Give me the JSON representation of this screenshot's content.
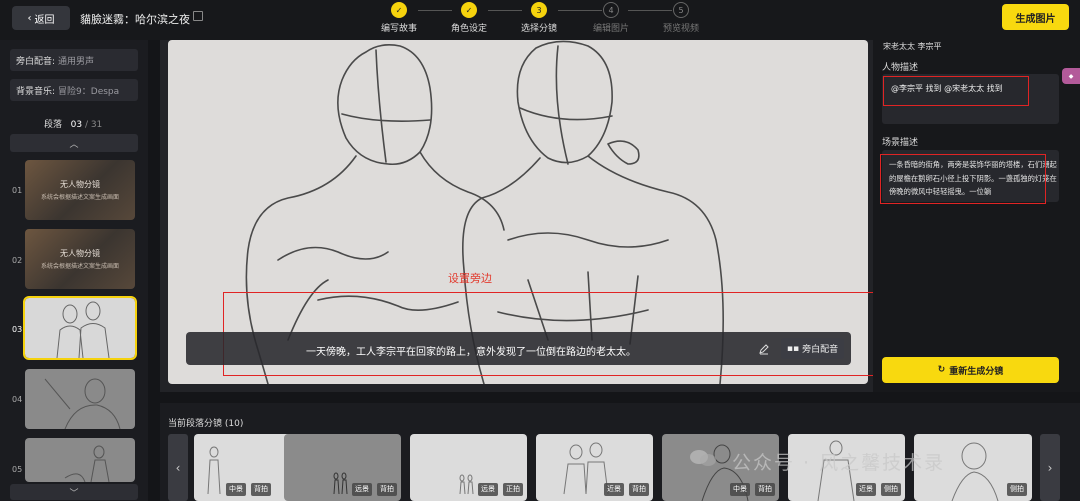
{
  "header": {
    "back_label": "返回",
    "project_title": "貓臉迷霧：哈尔滨之夜",
    "generate_label": "生成图片",
    "steps": [
      {
        "num": "✓",
        "label": "编写故事",
        "state": "done"
      },
      {
        "num": "✓",
        "label": "角色设定",
        "state": "done"
      },
      {
        "num": "3",
        "label": "选择分镜",
        "state": "current"
      },
      {
        "num": "4",
        "label": "编辑图片",
        "state": "todo"
      },
      {
        "num": "5",
        "label": "预览视频",
        "state": "todo"
      }
    ]
  },
  "left_panel": {
    "narration_key": "旁白配音:",
    "narration_value": "通用男声",
    "music_key": "背景音乐:",
    "music_value": "冒险9：Despa",
    "segment_label": "段落",
    "segment_current": "03",
    "segment_total": "/ 31",
    "segments": [
      {
        "num": "01",
        "kind": "placeholder",
        "title": "无人物分镜",
        "subtitle": "系统会根据描述文案生成画面"
      },
      {
        "num": "02",
        "kind": "placeholder",
        "title": "无人物分镜",
        "subtitle": "系统会根据描述文案生成画面"
      },
      {
        "num": "03",
        "kind": "sketch",
        "selected": true
      },
      {
        "num": "04",
        "kind": "sketch"
      },
      {
        "num": "05",
        "kind": "sketch"
      }
    ]
  },
  "preview": {
    "subtitle": "一天傍晚，工人李宗平在回家的路上，意外发现了一位倒在路边的老太太。",
    "voice_label": "旁白配音",
    "annotation": "设置旁边"
  },
  "right_panel": {
    "characters": "宋老太太  李宗平",
    "role_desc_label": "人物描述",
    "role_desc_value": "@李宗平 找到 @宋老太太 找到",
    "scene_label": "场景描述",
    "scene_value": "一条昏暗的街角，两旁是装饰华丽的塔楼，石们潮起的屋檐在鹅卵石小径上投下阴影。一盏孤独的灯笼在傍晚的微风中轻轻摇曳。一位躺",
    "regen_label": "重新生成分镜"
  },
  "strip": {
    "title": "当前段落分镜 (10)",
    "shots": [
      {
        "tags": [
          "中景",
          "背拍"
        ],
        "tone": "light"
      },
      {
        "tags": [
          "远景",
          "背拍"
        ],
        "tone": "dark"
      },
      {
        "tags": [
          "远景",
          "正拍"
        ],
        "tone": "light"
      },
      {
        "tags": [
          "近景",
          "背拍"
        ],
        "tone": "light"
      },
      {
        "tags": [
          "中景",
          "背拍"
        ],
        "tone": "dark"
      },
      {
        "tags": [
          "近景",
          "侧拍"
        ],
        "tone": "light"
      },
      {
        "tags": [
          "",
          "侧拍"
        ],
        "tone": "light"
      }
    ]
  },
  "watermark": "公众号 · 风之馨技术录",
  "colors": {
    "accent": "#f8d90f",
    "annotation": "#e02424",
    "background": "#141518"
  }
}
